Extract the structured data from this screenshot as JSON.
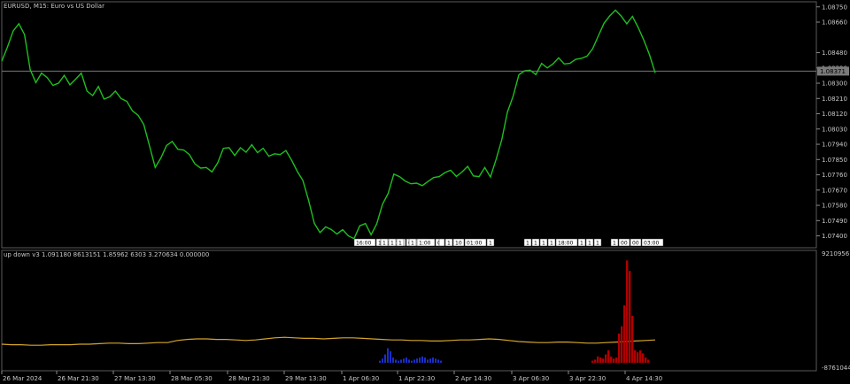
{
  "header": {
    "symbol_title": "EURUSD, M15:  Euro vs US Dollar",
    "indicator_title": "up down v3 1.091180 8613151 1.85962 6303 3.270634 0.000000"
  },
  "colors": {
    "background": "#000000",
    "grid": "#3a3a3a",
    "price_line": "#1fbf1f",
    "indicator_line": "#d4a52a",
    "hist_down": "#b00000",
    "hist_up": "#1a2fc8",
    "label_bg": "#ffffff"
  },
  "chart_data": [
    {
      "type": "line",
      "title": "EURUSD, M15: Euro vs US Dollar",
      "x_ticks": [
        "26 Mar 2024",
        "26 Mar 21:30",
        "27 Mar 13:30",
        "28 Mar 05:30",
        "28 Mar 21:30",
        "29 Mar 13:30",
        "1 Apr 06:30",
        "1 Apr 22:30",
        "2 Apr 14:30",
        "3 Apr 06:30",
        "3 Apr 22:30",
        "4 Apr 14:30"
      ],
      "y_ticks": [
        "1.08750",
        "1.08660",
        "1.08480",
        "1.08390",
        "1.08300",
        "1.08210",
        "1.08120",
        "1.08030",
        "1.07940",
        "1.07850",
        "1.07760",
        "1.07670",
        "1.07580",
        "1.07490",
        "1.07400"
      ],
      "ylim": [
        1.0733,
        1.0878
      ],
      "current_price": "1.08371",
      "series": [
        {
          "values": [
            1.0842,
            1.0851,
            1.0861,
            1.0866,
            1.0858,
            1.0838,
            1.0831,
            1.0835,
            1.0833,
            1.0829,
            1.0831,
            1.0834,
            1.0829,
            1.0833,
            1.0835,
            1.0825,
            1.0823,
            1.0829,
            1.082,
            1.0822,
            1.0826,
            1.082,
            1.0819,
            1.0814,
            1.0812,
            1.0805,
            1.0793,
            1.0781,
            1.0785,
            1.0793,
            1.0796,
            1.0792,
            1.079,
            1.0788,
            1.0783,
            1.0779,
            1.078,
            1.0778,
            1.0784,
            1.0791,
            1.0792,
            1.0788,
            1.0791,
            1.0789,
            1.0794,
            1.079,
            1.0791,
            1.0787,
            1.0789,
            1.0787,
            1.079,
            1.0785,
            1.0779,
            1.0772,
            1.0761,
            1.0748,
            1.0741,
            1.0745,
            1.0744,
            1.0742,
            1.0743,
            1.074,
            1.0739,
            1.0745,
            1.0747,
            1.0741,
            1.0748,
            1.0758,
            1.0765,
            1.0777,
            1.0774,
            1.0772,
            1.0771,
            1.0772,
            1.0769,
            1.0772,
            1.0775,
            1.0774,
            1.0777,
            1.0779,
            1.0776,
            1.0777,
            1.0781,
            1.0776,
            1.0774,
            1.078,
            1.0775,
            1.0786,
            1.0796,
            1.0813,
            1.0823,
            1.0834,
            1.0837,
            1.0838,
            1.0836,
            1.0841,
            1.0839,
            1.0842,
            1.0844,
            1.0841,
            1.0842,
            1.0845,
            1.0844,
            1.0846,
            1.0851,
            1.0857,
            1.0865,
            1.087,
            1.0874,
            1.0869,
            1.0865,
            1.087,
            1.0862,
            1.0855,
            1.0847,
            1.0837
          ]
        }
      ],
      "time_markers": [
        "16:00",
        "1",
        "18:00",
        "01:00",
        "1",
        "1",
        "1",
        "1",
        "1:00",
        "0",
        "",
        "1",
        "10",
        "01:00",
        "1",
        "1",
        "1",
        "1",
        "1",
        "18:00",
        "1",
        "1",
        "1",
        "1",
        "00",
        "00",
        "03:00"
      ]
    },
    {
      "type": "bar",
      "title": "up down v3",
      "y_ticks": [
        "92109561093",
        "-87610442604"
      ],
      "line_values": [
        -0.05,
        -0.06,
        -0.06,
        -0.07,
        -0.07,
        -0.06,
        -0.06,
        -0.06,
        -0.05,
        -0.05,
        -0.04,
        -0.03,
        -0.03,
        -0.04,
        -0.04,
        -0.03,
        -0.02,
        -0.02,
        0.02,
        0.04,
        0.05,
        0.05,
        0.04,
        0.04,
        0.03,
        0.02,
        0.03,
        0.05,
        0.07,
        0.08,
        0.07,
        0.06,
        0.06,
        0.05,
        0.06,
        0.07,
        0.07,
        0.06,
        0.05,
        0.04,
        0.03,
        0.03,
        0.02,
        0.02,
        0.01,
        0.01,
        0.02,
        0.03,
        0.03,
        0.04,
        0.05,
        0.04,
        0.02,
        0.0,
        -0.01,
        -0.02,
        -0.02,
        -0.01,
        -0.01,
        -0.02,
        -0.03,
        -0.03,
        -0.02,
        -0.01,
        0.0,
        0.01,
        0.02,
        0.03
      ],
      "up_bars": [
        0.02,
        0.04,
        0.08,
        0.14,
        0.11,
        0.05,
        0.03,
        0.02,
        0.03,
        0.04,
        0.05,
        0.03,
        0.02,
        0.03,
        0.04,
        0.05,
        0.06,
        0.05,
        0.03,
        0.04,
        0.05,
        0.04,
        0.03,
        0.02
      ],
      "down_bars": [
        0.02,
        0.03,
        0.06,
        0.05,
        0.04,
        0.08,
        0.12,
        0.06,
        0.04,
        0.05,
        0.28,
        0.35,
        0.55,
        0.98,
        0.88,
        0.45,
        0.12,
        0.1,
        0.12,
        0.09,
        0.05,
        0.03
      ],
      "ylim": [
        -1,
        1
      ]
    }
  ]
}
